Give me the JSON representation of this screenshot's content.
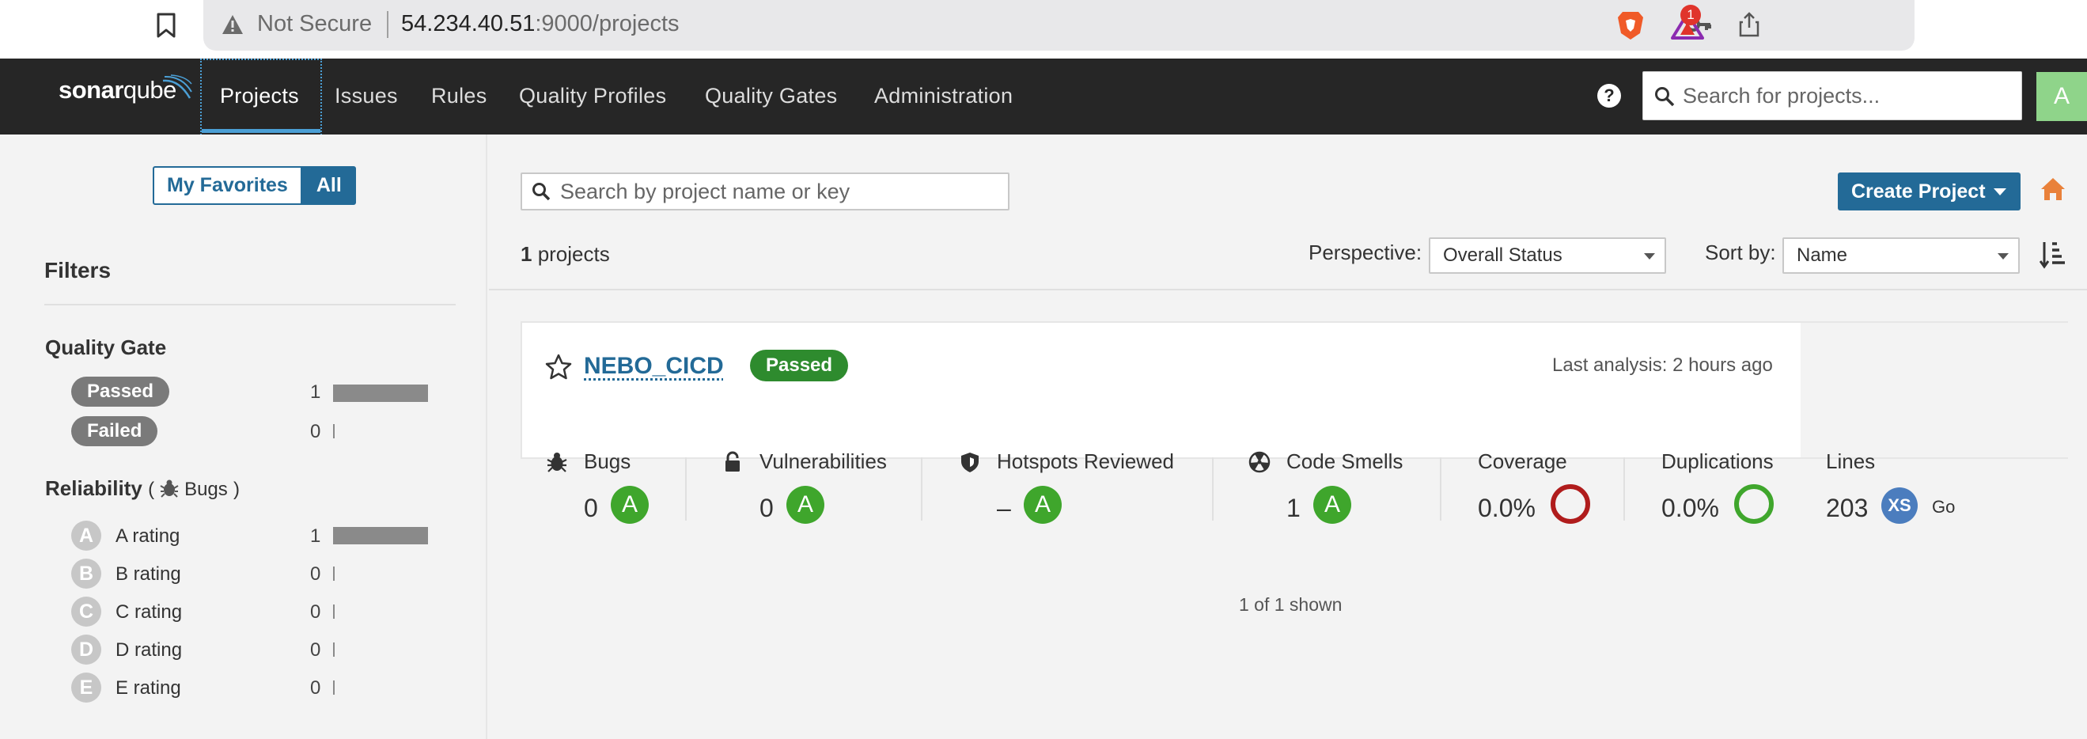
{
  "browser": {
    "not_secure": "Not Secure",
    "url_host": "54.234.40.51",
    "url_path": ":9000/projects",
    "rewards_badge": "1"
  },
  "nav": {
    "logo_bold": "sonar",
    "logo_light": "qube",
    "items": [
      "Projects",
      "Issues",
      "Rules",
      "Quality Profiles",
      "Quality Gates",
      "Administration"
    ],
    "help": "?",
    "search_placeholder": "Search for projects...",
    "avatar_letter": "A"
  },
  "sidebar": {
    "my_favorites": "My Favorites",
    "all": "All",
    "filters_title": "Filters",
    "quality_gate": {
      "title": "Quality Gate",
      "items": [
        {
          "label": "Passed",
          "count": "1",
          "fraction": 1.0
        },
        {
          "label": "Failed",
          "count": "0",
          "fraction": 0.0
        }
      ]
    },
    "reliability": {
      "title": "Reliability",
      "paren_open": "(",
      "sub": "Bugs",
      "paren_close": ")",
      "items": [
        {
          "letter": "A",
          "label": "A rating",
          "count": "1",
          "fraction": 1.0
        },
        {
          "letter": "B",
          "label": "B rating",
          "count": "0",
          "fraction": 0.0
        },
        {
          "letter": "C",
          "label": "C rating",
          "count": "0",
          "fraction": 0.0
        },
        {
          "letter": "D",
          "label": "D rating",
          "count": "0",
          "fraction": 0.0
        },
        {
          "letter": "E",
          "label": "E rating",
          "count": "0",
          "fraction": 0.0
        }
      ]
    }
  },
  "main": {
    "search_placeholder": "Search by project name or key",
    "create_project": "Create Project",
    "count_num": "1",
    "count_label": " projects",
    "perspective_label": "Perspective:",
    "perspective_value": "Overall Status",
    "sort_label": "Sort by:",
    "sort_value": "Name",
    "shown": "1 of 1 shown"
  },
  "project": {
    "name": "NEBO_CICD",
    "status": "Passed",
    "last_analysis": "Last analysis: 2 hours ago",
    "metrics": {
      "bugs": {
        "label": "Bugs",
        "value": "0",
        "grade": "A"
      },
      "vulnerabilities": {
        "label": "Vulnerabilities",
        "value": "0",
        "grade": "A"
      },
      "hotspots": {
        "label": "Hotspots Reviewed",
        "value": "–",
        "grade": "A"
      },
      "code_smells": {
        "label": "Code Smells",
        "value": "1",
        "grade": "A"
      },
      "coverage": {
        "label": "Coverage",
        "value": "0.0%"
      },
      "duplications": {
        "label": "Duplications",
        "value": "0.0%"
      },
      "lines": {
        "label": "Lines",
        "value": "203",
        "size": "XS",
        "language": "Go"
      }
    }
  },
  "colors": {
    "brand_blue": "#236a97",
    "passed_green": "#2e8b2e",
    "grade_a": "#3fa62c",
    "coverage_red": "#b01c1c",
    "duplication_green": "#3fa62c"
  }
}
